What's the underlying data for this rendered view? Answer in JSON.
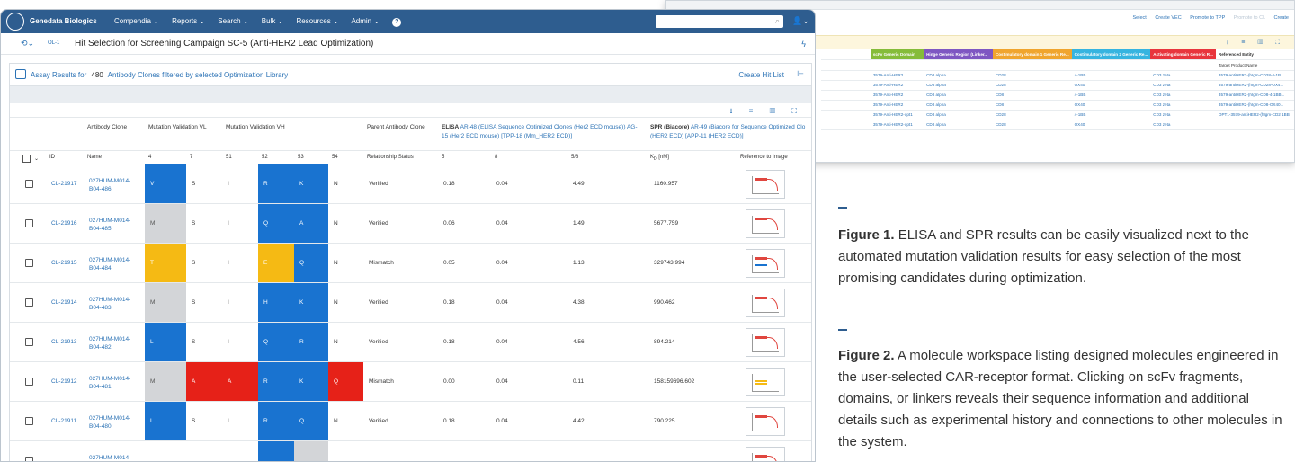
{
  "back": {
    "actions": [
      "Select",
      "Create VEC",
      "Promote to TPP",
      "Promote to CL",
      "Create"
    ],
    "header": [
      "",
      "scFv Generic Domain",
      "Hinge Generic Region (Linker...",
      "Costimulatory domain 1 Generic Re...",
      "Costimulatory domain 2 Generic Re...",
      "Activating domain Generic R...",
      "Referenced Entity"
    ],
    "header_colors": [
      "#ffffff",
      "#85bc3a",
      "#7e57c2",
      "#f0a52e",
      "#36b4e0",
      "#e8353d",
      "#ffffff"
    ],
    "col6_subheader": "Target Product Name",
    "rows": [
      [
        "",
        "3579-Anti-HER2",
        "CD8 alpha",
        "CD28",
        "4-1BB",
        "CD3 zeta",
        "3579-antiHER2-(hIgm-CD28-4-1B..."
      ],
      [
        "",
        "3579-Anti-HER2",
        "CD8 alpha",
        "CD28",
        "OX40",
        "CD3 zeta",
        "3579-antiHER2-(hIgm-CD28-OX4..."
      ],
      [
        "",
        "3579-Anti-HER2",
        "CD8 alpha",
        "CD8",
        "4-1BB",
        "CD3 zeta",
        "3579-antiHER2-(hIgm-CD8-4-1BB..."
      ],
      [
        "",
        "3579-Anti-HER2",
        "CD8 alpha",
        "CD8",
        "OX40",
        "CD3 zeta",
        "3579-antiHER2-(hIgm-CD8-OX40..."
      ],
      [
        "",
        "3579-Anti-HER2-opt1",
        "CD8 alpha",
        "CD28",
        "4-1BB",
        "CD3 zeta",
        "OPT1-3579-antiHER2-(hIgm-CD2 1BB"
      ],
      [
        "",
        "3579-Anti-HER2-opt1",
        "CD8 alpha",
        "CD28",
        "OX40",
        "CD3 zeta",
        ""
      ]
    ]
  },
  "nav": {
    "brand": "Genedata Biologics",
    "menu": [
      "Compendia ⌄",
      "Reports ⌄",
      "Search ⌄",
      "Bulk ⌄",
      "Resources ⌄",
      "Admin ⌄"
    ],
    "help": "?"
  },
  "crumb": {
    "ol": "OL-1",
    "title": "Hit Selection for Screening Campaign SC-5 (Anti-HER2 Lead Optimization)"
  },
  "panel": {
    "prefix": "Assay Results for",
    "count": "480",
    "suffix": "Antibody Clones filtered by selected Optimization Library",
    "create_hit_list": "Create Hit List"
  },
  "grid": {
    "group_headers": {
      "clone": "Antibody Clone",
      "vl": "Mutation Validation VL",
      "vh": "Mutation Validation VH",
      "parent": "Parent Antibody Clone",
      "elisa_prefix": "ELISA",
      "elisa_link": "AR-48 (ELISA Sequence Optimized Clones (Her2 ECD mouse)) AG-15 (Her2 ECD mouse) [TPP-18 (Mm_HER2 ECD)]",
      "spr_prefix": "SPR (Biacore)",
      "spr_link": "AR-49 (Biacore for Sequence Optimized Clo (HER2 ECD) [APP-11 (HER2 ECD)]"
    },
    "sub_headers": [
      "ID",
      "Name",
      "4",
      "7",
      "51",
      "52",
      "53",
      "54",
      "Relationship Status",
      "5",
      "8",
      "5/8",
      "KD [nM]",
      "Reference to Image"
    ],
    "rows": [
      {
        "id": "CL-21917",
        "name": "027HUM-M014-B04-486",
        "aa": [
          "V",
          "S",
          "I",
          "R",
          "K",
          "N"
        ],
        "colors": [
          "blue",
          "",
          "",
          "blue",
          "blue",
          ""
        ],
        "status": "Verified",
        "e5": "0.18",
        "e8": "0.04",
        "e58": "4.49",
        "kd": "1160.957",
        "img": "r"
      },
      {
        "id": "CL-21916",
        "name": "027HUM-M014-B04-485",
        "aa": [
          "M",
          "S",
          "I",
          "Q",
          "A",
          "N"
        ],
        "colors": [
          "gray",
          "",
          "",
          "blue",
          "blue",
          ""
        ],
        "status": "Verified",
        "e5": "0.06",
        "e8": "0.04",
        "e58": "1.49",
        "kd": "5677.759",
        "img": "r"
      },
      {
        "id": "CL-21915",
        "name": "027HUM-M014-B04-484",
        "aa": [
          "T",
          "S",
          "I",
          "E",
          "Q",
          "N"
        ],
        "colors": [
          "yellow",
          "",
          "",
          "yellow",
          "blue",
          ""
        ],
        "status": "Mismatch",
        "e5": "0.05",
        "e8": "0.04",
        "e58": "1.13",
        "kd": "329743.994",
        "img": "m"
      },
      {
        "id": "CL-21914",
        "name": "027HUM-M014-B04-483",
        "aa": [
          "M",
          "S",
          "I",
          "H",
          "K",
          "N"
        ],
        "colors": [
          "gray",
          "",
          "",
          "blue",
          "blue",
          ""
        ],
        "status": "Verified",
        "e5": "0.18",
        "e8": "0.04",
        "e58": "4.38",
        "kd": "990.462",
        "img": "r"
      },
      {
        "id": "CL-21913",
        "name": "027HUM-M014-B04-482",
        "aa": [
          "L",
          "S",
          "I",
          "Q",
          "R",
          "N"
        ],
        "colors": [
          "blue",
          "",
          "",
          "blue",
          "blue",
          ""
        ],
        "status": "Verified",
        "e5": "0.18",
        "e8": "0.04",
        "e58": "4.56",
        "kd": "894.214",
        "img": "r"
      },
      {
        "id": "CL-21912",
        "name": "027HUM-M014-B04-481",
        "aa": [
          "M",
          "A",
          "A",
          "R",
          "K",
          "Q"
        ],
        "colors": [
          "gray",
          "red",
          "red",
          "blue",
          "blue",
          "red"
        ],
        "status": "Mismatch",
        "e5": "0.00",
        "e8": "0.04",
        "e58": "0.11",
        "kd": "158159696.602",
        "img": "g"
      },
      {
        "id": "CL-21911",
        "name": "027HUM-M014-B04-480",
        "aa": [
          "L",
          "S",
          "I",
          "R",
          "Q",
          "N"
        ],
        "colors": [
          "blue",
          "",
          "",
          "blue",
          "blue",
          ""
        ],
        "status": "Verified",
        "e5": "0.18",
        "e8": "0.04",
        "e58": "4.42",
        "kd": "790.225",
        "img": "r"
      },
      {
        "id": "",
        "name": "027HUM-M014-",
        "aa": [
          "",
          "",
          "",
          "",
          "",
          ""
        ],
        "colors": [
          "",
          "",
          "",
          "blue",
          "gray",
          ""
        ],
        "status": "",
        "e5": "",
        "e8": "",
        "e58": "",
        "kd": "",
        "img": "r"
      }
    ]
  },
  "captions": [
    {
      "label": "Figure 1.",
      "text": "ELISA and SPR results can be easily visualized next to the automated mutation validation results for easy selection of the most promising candidates during optimization."
    },
    {
      "label": "Figure 2.",
      "text": "A molecule workspace listing designed molecules engineered in the user-selected CAR-receptor format. Clicking on scFv fragments, domains, or linkers reveals their sequence information and additional details such as experimental history and connections to other molecules in the system."
    }
  ]
}
